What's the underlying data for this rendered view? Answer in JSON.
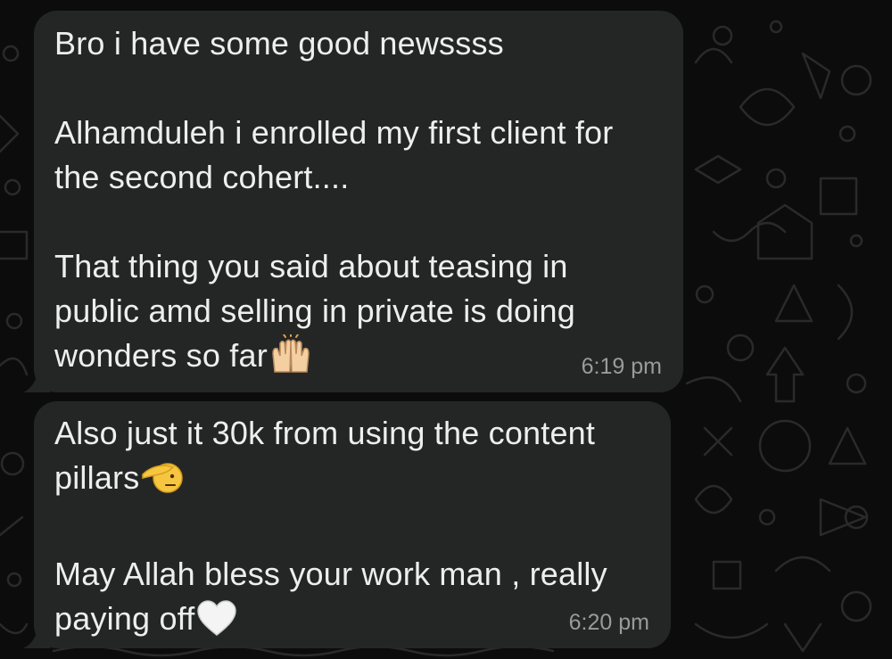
{
  "messages": [
    {
      "lines": [
        "Bro i have some good newssss",
        "",
        "Alhamduleh i enrolled my first client for",
        "the second cohert....",
        "",
        "That thing you said about teasing in",
        "public amd selling in private is doing",
        "wonders so far"
      ],
      "emoji": "raising-hands-icon",
      "time": "6:19 pm"
    },
    {
      "lines": [
        "Also just it 30k from using the content",
        "pillars",
        "",
        "May Allah bless your work man , really",
        "paying off"
      ],
      "emoji_after_pillars": "saluting-face-icon",
      "emoji_end": "white-heart-icon",
      "time": "6:20 pm"
    }
  ],
  "colors": {
    "bubble": "#242626",
    "text": "#eeeeee",
    "time": "#9a9a9a",
    "wallpaper": "#0c0c0c"
  }
}
